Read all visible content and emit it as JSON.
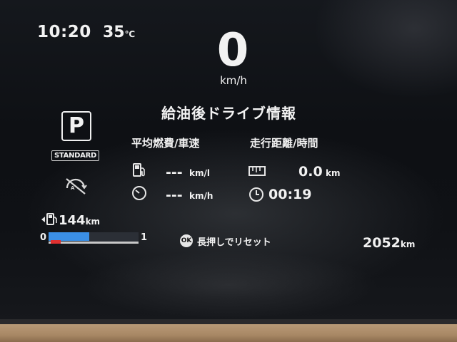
{
  "status": {
    "time": "10:20",
    "temperature": "35",
    "temp_unit": "℃"
  },
  "speed": {
    "value": "0",
    "unit": "km/h"
  },
  "trip": {
    "title": "給油後ドライブ情報",
    "avg_label": "平均燃費/車速",
    "dist_label": "走行距離/時間",
    "fuel_economy": {
      "value": "---",
      "unit": "km/l"
    },
    "avg_speed": {
      "value": "---",
      "unit": "km/h"
    },
    "distance": {
      "value": "0.0",
      "unit": "km"
    },
    "duration": {
      "value": "00:19"
    }
  },
  "indicators": {
    "gear": "P",
    "drive_mode": "STANDARD"
  },
  "range": {
    "value": "144",
    "unit": "km"
  },
  "bar": {
    "min_label": "0",
    "max_label": "1",
    "level": 0.45
  },
  "reset": {
    "button_label": "OK",
    "text": "長押しでリセット"
  },
  "odometer": {
    "value": "2052",
    "unit": "km"
  },
  "colors": {
    "accent": "#3b8fe6",
    "warning": "#e03030"
  }
}
